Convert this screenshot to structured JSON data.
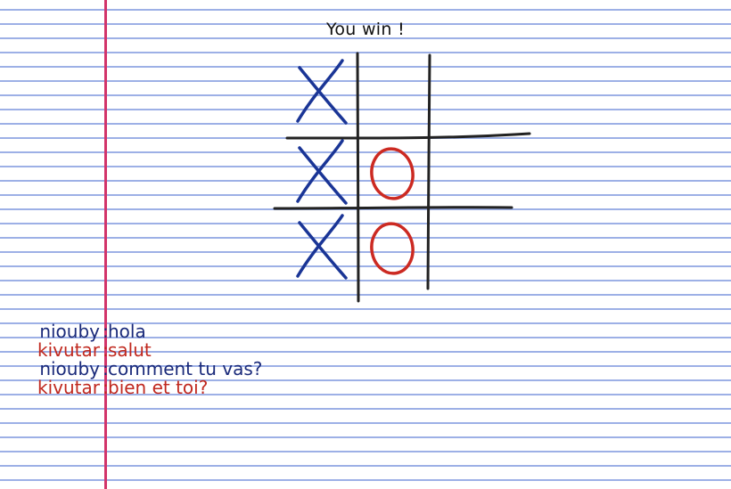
{
  "status": "You win !",
  "colors": {
    "x_mark": "#1a3596",
    "o_mark": "#cc2a22",
    "grid": "#222222",
    "paper_lines": "#9db0e6",
    "margin": "#d2346a",
    "nick_niouby": "#1a2a7a",
    "nick_kivutar": "#c0281e"
  },
  "board": {
    "cells": [
      "X",
      "",
      "",
      "X",
      "O",
      "",
      "X",
      "O",
      ""
    ]
  },
  "chat": [
    {
      "nick": "niouby",
      "sep": ":",
      "text": "hola",
      "color": "#1a2a7a"
    },
    {
      "nick": "kivutar",
      "sep": ":",
      "text": "salut",
      "color": "#c0281e"
    },
    {
      "nick": "niouby",
      "sep": ":",
      "text": "comment tu vas?",
      "color": "#1a2a7a"
    },
    {
      "nick": "kivutar",
      "sep": ":",
      "text": "bien et toi?",
      "color": "#c0281e"
    }
  ]
}
